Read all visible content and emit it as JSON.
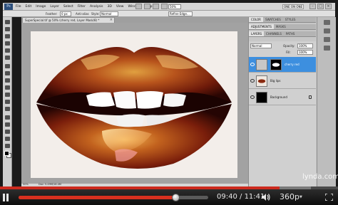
{
  "appbar": {
    "logo": "Ps",
    "menus": [
      "File",
      "Edit",
      "Image",
      "Layer",
      "Select",
      "Filter",
      "Analysis",
      "3D",
      "View",
      "Window",
      "Help"
    ],
    "zoom": "50%",
    "workspace": "ONE ON ONE"
  },
  "options": {
    "feather_label": "Feather:",
    "feather_value": "0 px",
    "antialias_label": "Anti-alias",
    "style_label": "Style:",
    "style_value": "Normal",
    "refine_label": "Refine Edge..."
  },
  "document": {
    "tab_title": "SuperSpecial.tif @ 50% (cherry red, Layer Mask/8) *",
    "status_zoom": "50%",
    "status_doc": "Doc: 5.49M/16.4M"
  },
  "panels": {
    "top_tabs": [
      "COLOR",
      "SWATCHES",
      "STYLES"
    ],
    "adj_tabs": [
      "ADJUSTMENTS",
      "MASKS"
    ],
    "layer_tabs": [
      "LAYERS",
      "CHANNELS",
      "PATHS"
    ],
    "blend_mode": "Normal",
    "opacity_label": "Opacity:",
    "opacity_value": "100%",
    "fill_label": "Fill:",
    "fill_value": "100%",
    "layers": [
      {
        "name": "cherry red",
        "selected": true
      },
      {
        "name": "Big lips",
        "selected": false
      },
      {
        "name": "Background",
        "selected": false
      }
    ]
  },
  "player": {
    "current_time": "09:40",
    "duration": "11:41",
    "time_separator": " / ",
    "played_fraction": 0.828,
    "buffered_fraction": 0.92,
    "quality": "360p",
    "quality_caret": "▼",
    "watermark": "lynda.com"
  },
  "colors": {
    "progress_red": "#cc2a1e",
    "selected_layer": "#3d8fdf"
  }
}
